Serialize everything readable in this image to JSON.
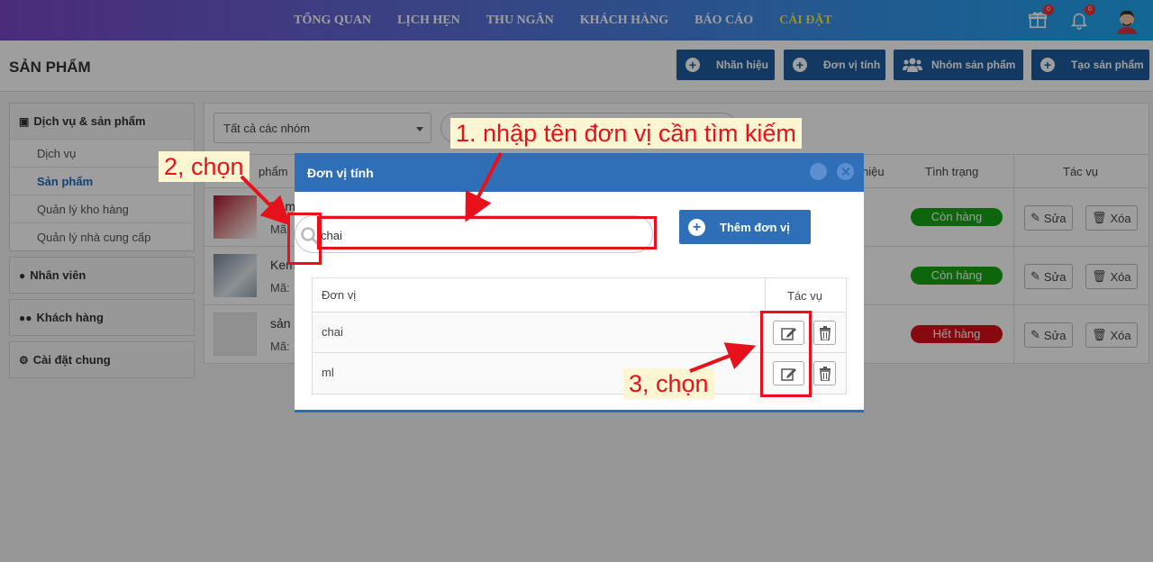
{
  "nav": {
    "items": [
      "TỔNG QUAN",
      "LỊCH HẸN",
      "THU NGÂN",
      "KHÁCH HÀNG",
      "BÁO CÁO",
      "CÀI ĐẶT"
    ],
    "gift_badge": "0",
    "bell_badge": "0"
  },
  "header": {
    "title": "SẢN PHẨM",
    "brand_label": "Nhãn hiệu",
    "unit_label": "Đơn vị tính",
    "group_label": "Nhóm sản phẩm",
    "create_label": "Tạo sản phẩm"
  },
  "sidebar": {
    "services_products": "Dịch vụ & sản phẩm",
    "items": [
      "Dịch vụ",
      "Sản phẩm",
      "Quản lý kho hàng",
      "Quản lý nhà cung cấp"
    ],
    "staff": "Nhân viên",
    "customers": "Khách hàng",
    "settings": "Cài đặt chung"
  },
  "main": {
    "group_select": "Tất cả các nhóm",
    "col_product": "phẩm",
    "col_brand": "hiệu",
    "col_status": "Tình trạng",
    "col_actions": "Tác vụ",
    "rows": [
      {
        "name": "Tâm",
        "code": "Mã:",
        "status": "Còn hàng"
      },
      {
        "name": "Kem",
        "code": "Mã:",
        "status": "Còn hàng"
      },
      {
        "name": "sản",
        "code": "Mã:",
        "status": "Hết hàng"
      }
    ],
    "edit_label": "Sửa",
    "delete_label": "Xóa"
  },
  "modal": {
    "title": "Đơn vị tính",
    "search_value": "chai",
    "add_label": "Thêm đơn vị",
    "col_unit": "Đơn vị",
    "col_actions": "Tác vụ",
    "units": [
      "chai",
      "ml"
    ]
  },
  "annotations": {
    "step1": "1. nhập tên đơn vị cần tìm kiếm",
    "step2": "2, chọn",
    "step3": "3, chọn"
  },
  "colors": {
    "primary": "#2e6fb8",
    "in_stock": "#16a314",
    "out_of_stock": "#d80f1a",
    "annotation": "#e8101a"
  }
}
